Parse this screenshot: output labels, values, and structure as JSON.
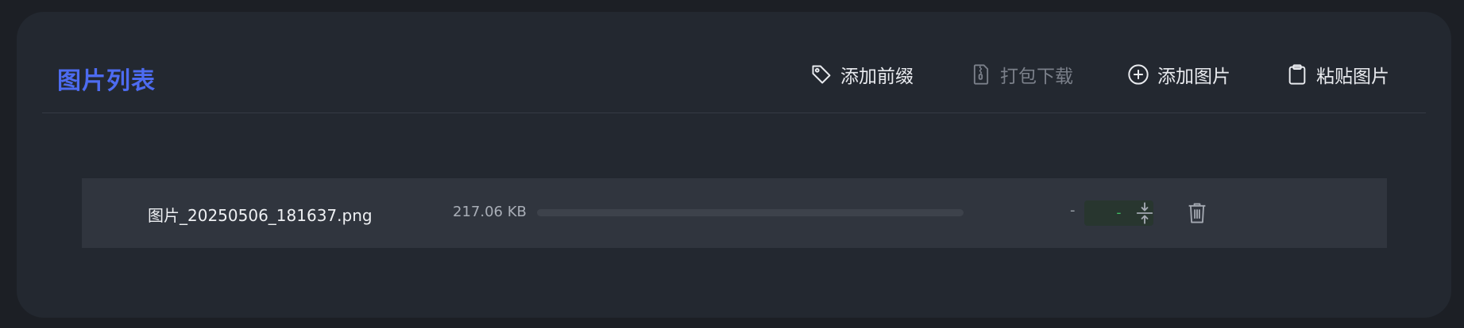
{
  "header": {
    "title": "图片列表"
  },
  "actions": {
    "add_prefix": "添加前缀",
    "pack_download": "打包下载",
    "add_image": "添加图片",
    "paste_image": "粘贴图片"
  },
  "icons": {
    "add_prefix": "tag-icon",
    "pack_download": "zip-file-icon",
    "add_image": "plus-circle-icon",
    "paste_image": "clipboard-icon",
    "compress": "compress-vertical-icon",
    "delete": "trash-icon"
  },
  "files": [
    {
      "name": "图片_20250506_181637.png",
      "original_size": "217.06 KB",
      "progress_fraction": 0,
      "compressed_size": "-",
      "ratio": "-"
    }
  ],
  "colors": {
    "accent": "#4d6bf0",
    "success": "#3fbf62",
    "background": "#1c1f25",
    "panel": "#232830",
    "row": "#30353e"
  }
}
